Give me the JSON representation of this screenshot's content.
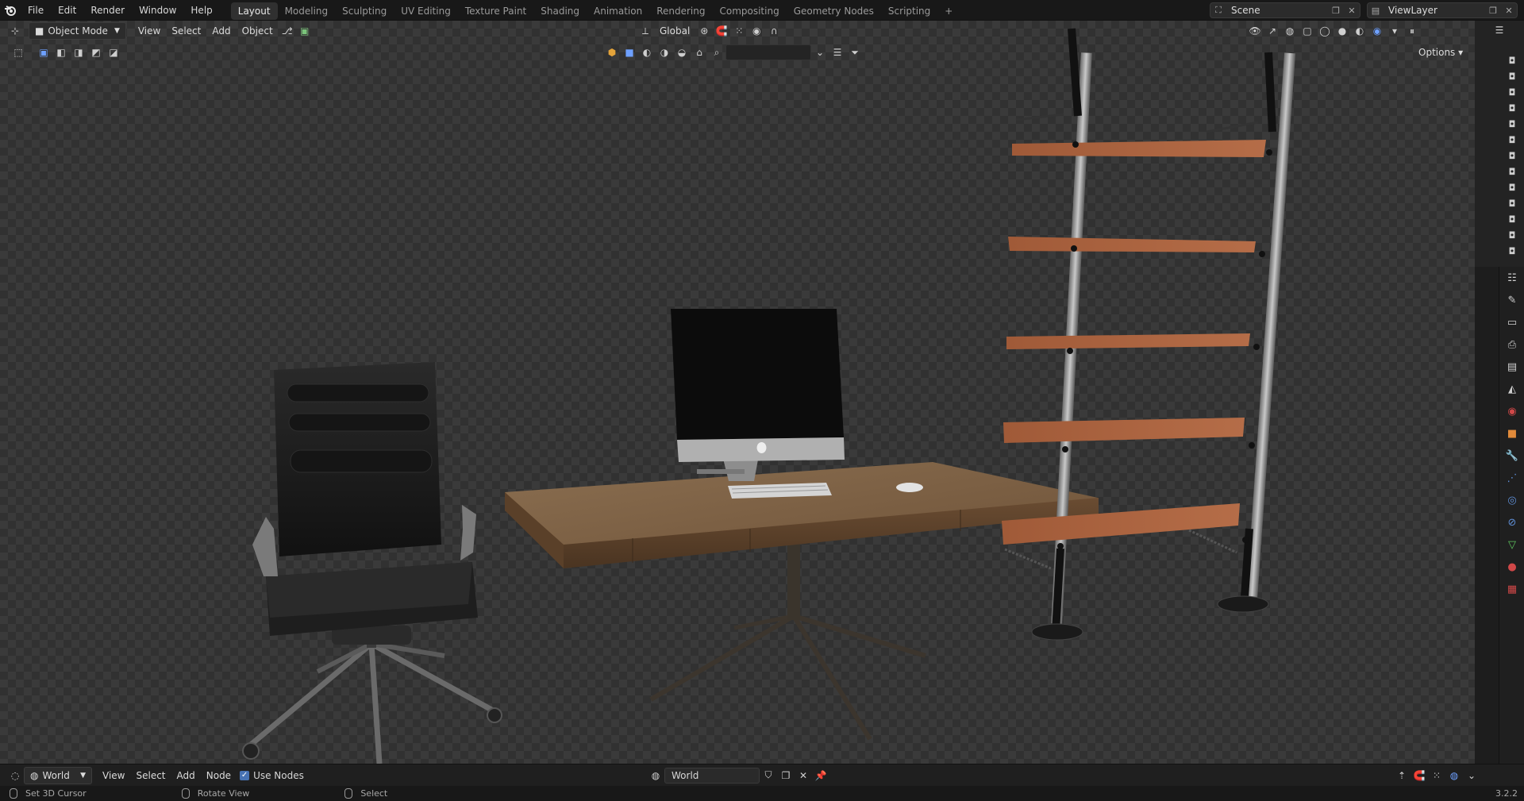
{
  "topbar": {
    "menus": [
      "File",
      "Edit",
      "Render",
      "Window",
      "Help"
    ],
    "workspaces": [
      "Layout",
      "Modeling",
      "Sculpting",
      "UV Editing",
      "Texture Paint",
      "Shading",
      "Animation",
      "Rendering",
      "Compositing",
      "Geometry Nodes",
      "Scripting"
    ],
    "active_workspace": "Layout",
    "add_tab": "+",
    "scene": "Scene",
    "view_layer": "ViewLayer"
  },
  "viewport_header": {
    "mode": "Object Mode",
    "menus": [
      "View",
      "Select",
      "Add",
      "Object"
    ],
    "transform_orientation": "Global",
    "options": "Options"
  },
  "node_header": {
    "world_selector": "World",
    "menus": [
      "View",
      "Select",
      "Add",
      "Node"
    ],
    "use_nodes_label": "Use Nodes",
    "use_nodes_checked": true,
    "world_name": "World"
  },
  "statusbar": {
    "items": [
      "Set 3D Cursor",
      "Rotate View",
      "Select"
    ],
    "version": "3.2.2"
  },
  "colors": {
    "accent": "#4772b3",
    "active_tab": "#303030",
    "background": "#1d1d1d"
  }
}
